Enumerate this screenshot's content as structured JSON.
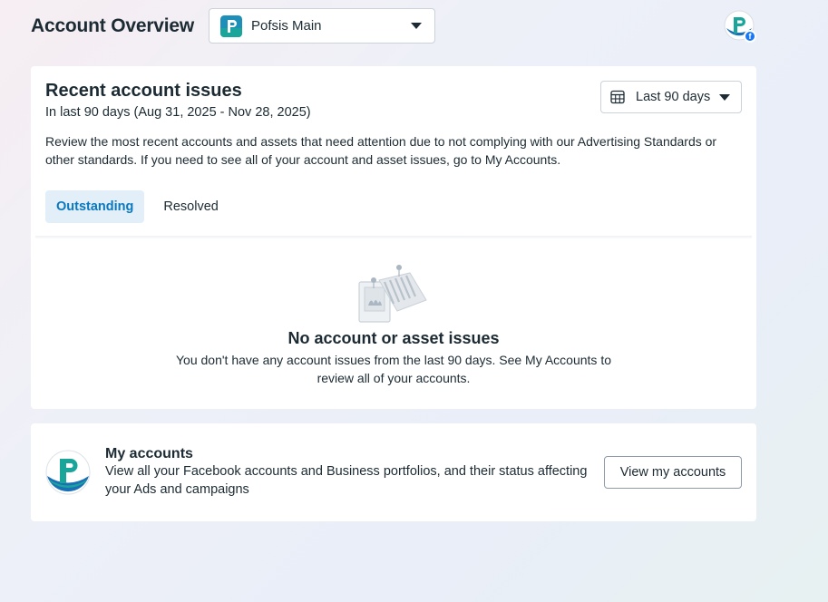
{
  "header": {
    "title": "Account Overview",
    "account_selector": {
      "selected": "Pofsis Main",
      "logo_icon": "pofsis-logo-icon"
    },
    "profile_badge_icon": "facebook-icon"
  },
  "issues_card": {
    "title": "Recent account issues",
    "subtitle": "In last 90 days (Aug 31, 2025 - Nov 28, 2025)",
    "description": "Review the most recent accounts and assets that need attention due to not complying with our Advertising Standards or other standards. If you need to see all of your account and asset issues, go to My Accounts.",
    "date_range": {
      "label": "Last 90 days",
      "icon": "calendar-icon"
    },
    "tabs": [
      {
        "label": "Outstanding",
        "active": true
      },
      {
        "label": "Resolved",
        "active": false
      }
    ],
    "empty_state": {
      "title": "No account or asset issues",
      "text": "You don't have any account issues from the last 90 days. See My Accounts to review all of your accounts."
    }
  },
  "accounts_card": {
    "title": "My accounts",
    "description": "View all your Facebook accounts and Business portfolios, and their status affecting your Ads and campaigns",
    "button_label": "View my accounts"
  },
  "colors": {
    "accent": "#0a78be",
    "tab_active_bg": "#e2eef8",
    "brand_teal": "#1aa59a",
    "brand_blue": "#1a6fb6",
    "facebook_blue": "#1877f2"
  }
}
